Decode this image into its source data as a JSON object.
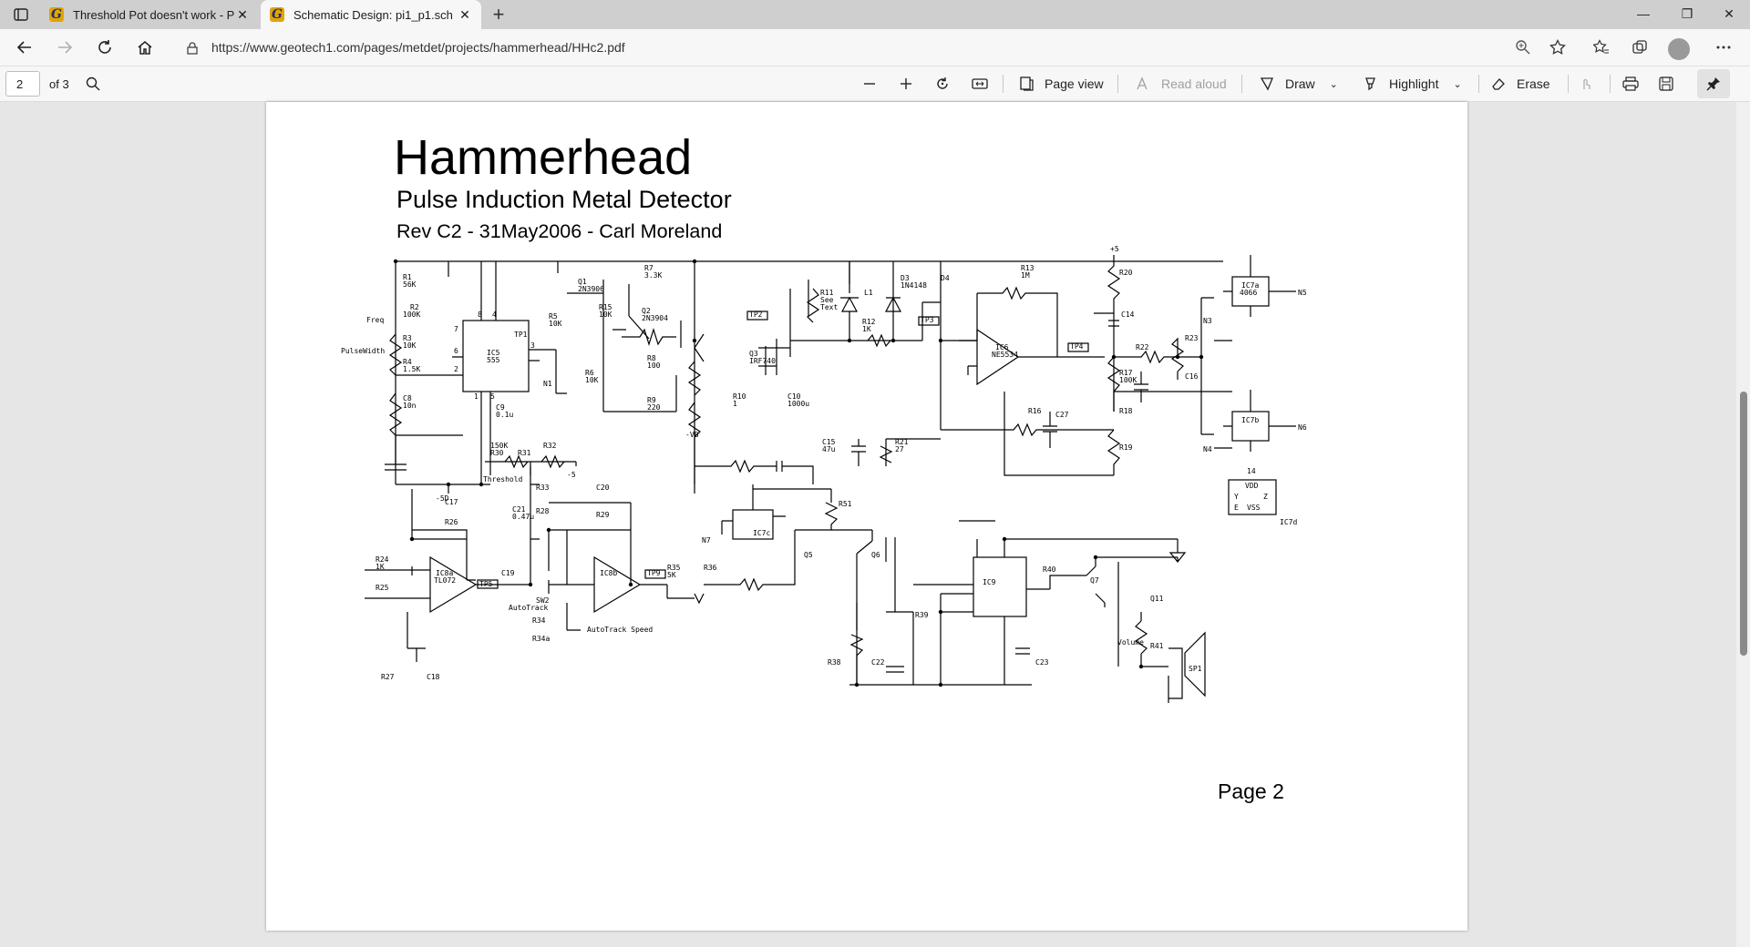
{
  "browser": {
    "tabs": [
      {
        "title": "Threshold Pot doesn't work - Pa",
        "active": false
      },
      {
        "title": "Schematic Design: pi1_p1.sch",
        "active": true
      }
    ],
    "new_tab": "+",
    "url": "https://www.geotech1.com/pages/metdet/projects/hammerhead/HHc2.pdf"
  },
  "pdf_toolbar": {
    "page_number": "2",
    "page_total": "of 3",
    "page_view": "Page view",
    "read_aloud": "Read aloud",
    "draw": "Draw",
    "highlight": "Highlight",
    "erase": "Erase"
  },
  "document": {
    "title": "Hammerhead",
    "subtitle": "Pulse Induction Metal Detector",
    "revision": "Rev C2 - 31May2006 - Carl Moreland",
    "page_label": "Page 2"
  },
  "schematic_labels": [
    "R1",
    "56K",
    "R2",
    "100K",
    "Freq",
    "R3",
    "10K",
    "PulseWidth",
    "R4",
    "1.5K",
    "C8",
    "10n",
    "IC5",
    "555",
    "8",
    "4",
    "7",
    "6",
    "2",
    "3",
    "1",
    "5",
    "C9",
    "0.1u",
    "-5D",
    "TP1",
    "N1",
    "R5",
    "10K",
    "Q1",
    "2N3906",
    "R15",
    "10K",
    "R6",
    "10K",
    "R7",
    "3.3K",
    "Q2",
    "2N3904",
    "R8",
    "100",
    "R9",
    "220",
    "-VB",
    "Q3",
    "IRF740",
    "R10",
    "1",
    "C10",
    "1000u",
    "TP2",
    "R11",
    "See",
    "Text",
    "L1",
    "R12",
    "1K",
    "D3",
    "1N4148",
    "D4",
    "TP3",
    "R13",
    "1M",
    "IC6",
    "NE5534",
    "TP4",
    "R16",
    "C15",
    "47u",
    "R21",
    "27",
    "R20",
    "+5",
    "C14",
    "R22",
    "R17",
    "100K",
    "R18",
    "R19",
    "C27",
    "R23",
    "C16",
    "IC7a",
    "4066",
    "N5",
    "N3",
    "IC7b",
    "N6",
    "N4",
    "14",
    "VDD",
    "Y",
    "Z",
    "E",
    "VSS",
    "IC7d",
    "R30",
    "150K",
    "R31",
    "R32",
    "Threshold",
    "-5",
    "C17",
    "R26",
    "R33",
    "C21",
    "0.47u",
    "R28",
    "C20",
    "R29",
    "IC8a",
    "TL072",
    "R24",
    "1K",
    "R25",
    "TP5",
    "C19",
    "SW2",
    "AutoTrack",
    "IC8b",
    "R34",
    "R34a",
    "AutoTrack Speed",
    "TP9",
    "R35",
    "5K",
    "R36",
    "IC7c",
    "N7",
    "R51",
    "Q5",
    "Q6",
    "R39",
    "R38",
    "C22",
    "IC9",
    "C23",
    "R40",
    "Q7",
    "Q11",
    "Volume",
    "R41",
    "SP1",
    "R27",
    "C18"
  ]
}
